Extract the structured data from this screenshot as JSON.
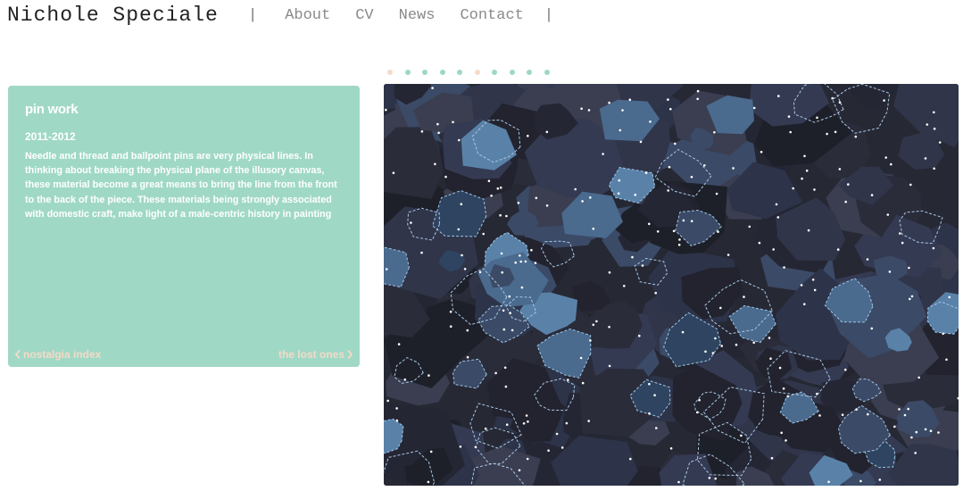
{
  "header": {
    "site_title": "Nichole Speciale",
    "separator": "|",
    "nav": [
      "About",
      "CV",
      "News",
      "Contact"
    ]
  },
  "slideshow": {
    "dot_count": 10,
    "highlighted_dots": [
      0,
      5
    ],
    "dot_color": "#9dd8c5",
    "highlight_color": "#f5dcc9"
  },
  "work": {
    "title": "pin work",
    "year": "2011-2012",
    "description": "Needle and thread and ballpoint pins are very physical lines. In thinking about breaking the physical plane of the illusory canvas, these material become a great means to bring the line from the front to the back of the piece. These materials being strongly associated with domestic craft, make light of a male-centric history in painting",
    "prev_label": "nostalgia index",
    "next_label": "the lost ones"
  },
  "colors": {
    "panel": "#a0d8c6",
    "link": "#f4dbc6",
    "artwork_base": "#1c1c22"
  },
  "icons": {
    "prev": "chevron-left-icon",
    "next": "chevron-right-icon"
  }
}
